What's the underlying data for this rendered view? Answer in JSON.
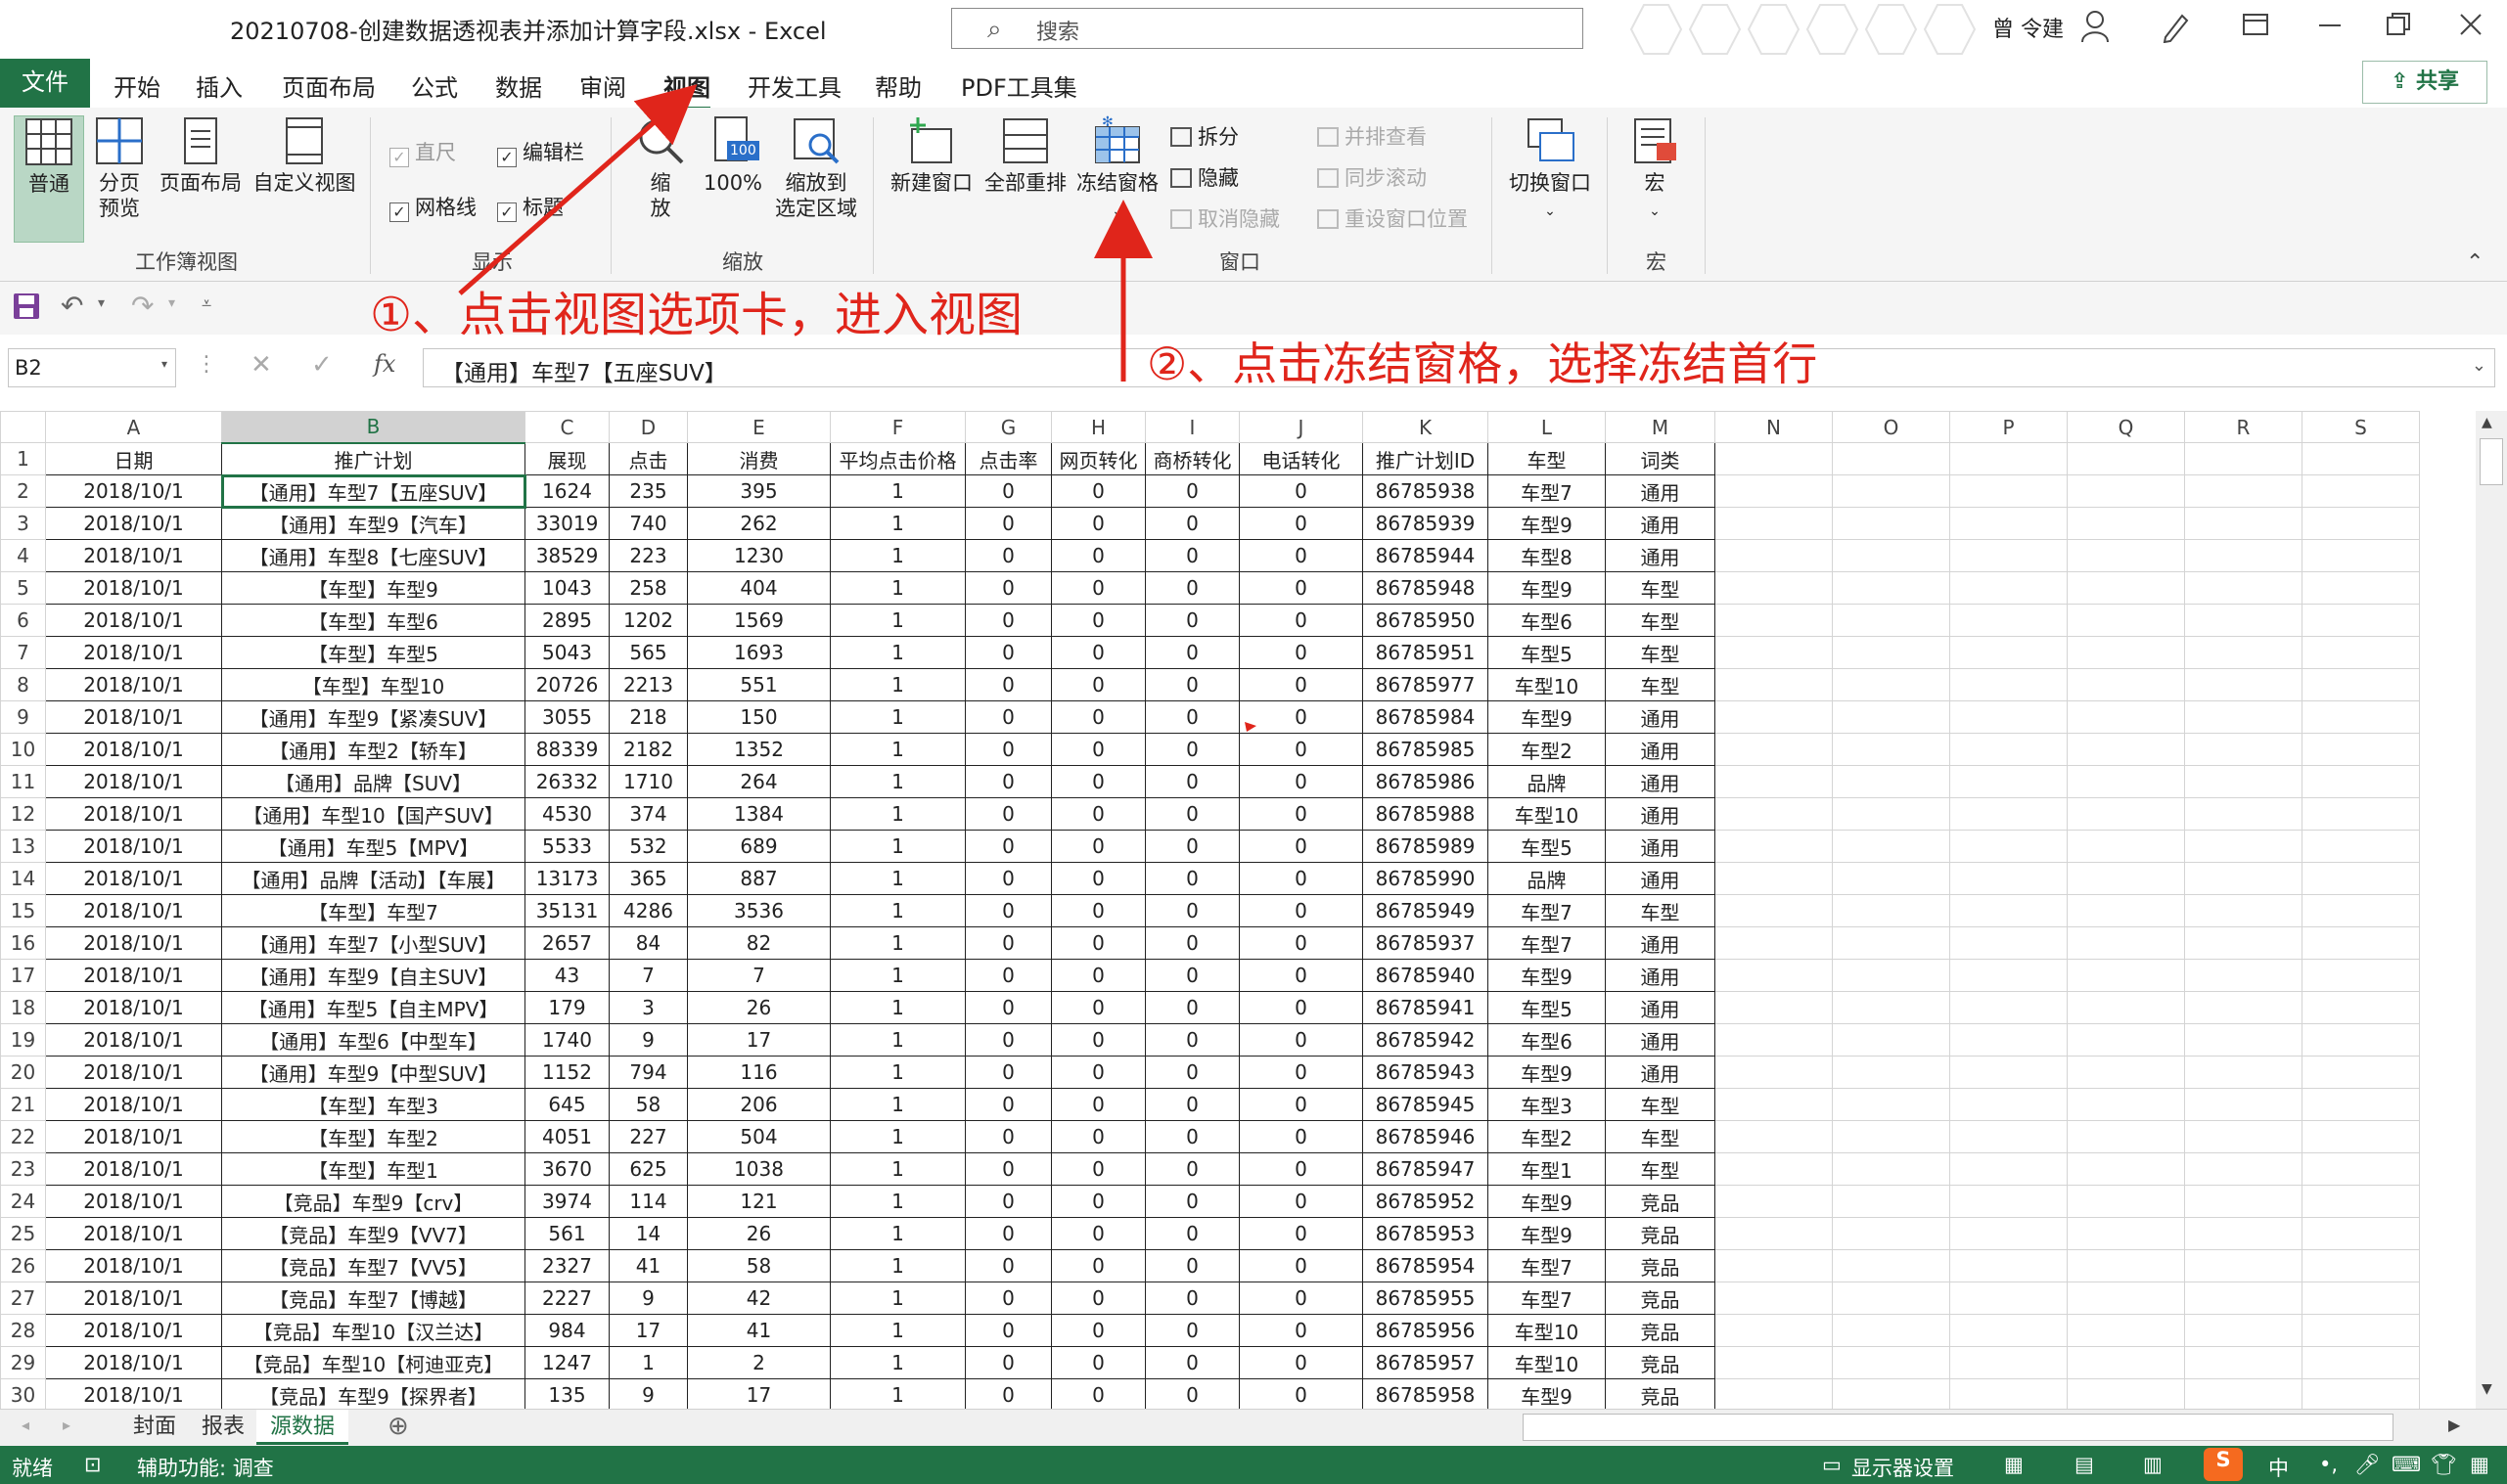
{
  "window": {
    "title": "20210708-创建数据透视表并添加计算字段.xlsx  -  Excel",
    "search_placeholder": "搜索",
    "user": "曾 令建"
  },
  "ribbon_tabs": [
    "文件",
    "开始",
    "插入",
    "页面布局",
    "公式",
    "数据",
    "审阅",
    "视图",
    "开发工具",
    "帮助",
    "PDF工具集"
  ],
  "active_tab": "视图",
  "share_label": "共享",
  "groups": {
    "workbook_views": {
      "label": "工作簿视图",
      "normal": "普通",
      "page_break_1": "分页",
      "page_break_2": "预览",
      "page_layout": "页面布局",
      "custom_views": "自定义视图"
    },
    "show": {
      "label": "显示",
      "ruler": "直尺",
      "formula_bar": "编辑栏",
      "gridlines": "网格线",
      "headings": "标题"
    },
    "zoom": {
      "label": "缩放",
      "zoom_1": "缩",
      "zoom_2": "放",
      "pct100": "100%",
      "pct100_badge": "100",
      "zoom_sel_1": "缩放到",
      "zoom_sel_2": "选定区域"
    },
    "window": {
      "label": "窗口",
      "new_window": "新建窗口",
      "arrange_all": "全部重排",
      "freeze_panes": "冻结窗格",
      "split": "拆分",
      "hide": "隐藏",
      "unhide": "取消隐藏",
      "side_by_side": "并排查看",
      "sync_scroll": "同步滚动",
      "reset_position": "重设窗口位置",
      "switch_windows": "切换窗口"
    },
    "macros": {
      "label": "宏",
      "macro": "宏"
    }
  },
  "annotations": {
    "step1": "①、点击视图选项卡，进入视图",
    "step2": "②、点击冻结窗格，选择冻结首行"
  },
  "formula": {
    "name_box": "B2",
    "content": "【通用】车型7【五座SUV】"
  },
  "column_letters": [
    "A",
    "B",
    "C",
    "D",
    "E",
    "F",
    "G",
    "H",
    "I",
    "J",
    "K",
    "L",
    "M",
    "N",
    "O",
    "P",
    "Q",
    "R",
    "S"
  ],
  "headers": [
    "日期",
    "推广计划",
    "展现",
    "点击",
    "消费",
    "平均点击价格",
    "点击率",
    "网页转化",
    "商桥转化",
    "电话转化",
    "推广计划ID",
    "车型",
    "词类"
  ],
  "rows": [
    [
      "2018/10/1",
      "【通用】车型7【五座SUV】",
      "1624",
      "235",
      "395",
      "1",
      "0",
      "0",
      "0",
      "0",
      "86785938",
      "车型7",
      "通用"
    ],
    [
      "2018/10/1",
      "【通用】车型9【汽车】",
      "33019",
      "740",
      "262",
      "1",
      "0",
      "0",
      "0",
      "0",
      "86785939",
      "车型9",
      "通用"
    ],
    [
      "2018/10/1",
      "【通用】车型8【七座SUV】",
      "38529",
      "223",
      "1230",
      "1",
      "0",
      "0",
      "0",
      "0",
      "86785944",
      "车型8",
      "通用"
    ],
    [
      "2018/10/1",
      "【车型】车型9",
      "1043",
      "258",
      "404",
      "1",
      "0",
      "0",
      "0",
      "0",
      "86785948",
      "车型9",
      "车型"
    ],
    [
      "2018/10/1",
      "【车型】车型6",
      "2895",
      "1202",
      "1569",
      "1",
      "0",
      "0",
      "0",
      "0",
      "86785950",
      "车型6",
      "车型"
    ],
    [
      "2018/10/1",
      "【车型】车型5",
      "5043",
      "565",
      "1693",
      "1",
      "0",
      "0",
      "0",
      "0",
      "86785951",
      "车型5",
      "车型"
    ],
    [
      "2018/10/1",
      "【车型】车型10",
      "20726",
      "2213",
      "551",
      "1",
      "0",
      "0",
      "0",
      "0",
      "86785977",
      "车型10",
      "车型"
    ],
    [
      "2018/10/1",
      "【通用】车型9【紧凑SUV】",
      "3055",
      "218",
      "150",
      "1",
      "0",
      "0",
      "0",
      "0",
      "86785984",
      "车型9",
      "通用"
    ],
    [
      "2018/10/1",
      "【通用】车型2【轿车】",
      "88339",
      "2182",
      "1352",
      "1",
      "0",
      "0",
      "0",
      "0",
      "86785985",
      "车型2",
      "通用"
    ],
    [
      "2018/10/1",
      "【通用】品牌【SUV】",
      "26332",
      "1710",
      "264",
      "1",
      "0",
      "0",
      "0",
      "0",
      "86785986",
      "品牌",
      "通用"
    ],
    [
      "2018/10/1",
      "【通用】车型10【国产SUV】",
      "4530",
      "374",
      "1384",
      "1",
      "0",
      "0",
      "0",
      "0",
      "86785988",
      "车型10",
      "通用"
    ],
    [
      "2018/10/1",
      "【通用】车型5【MPV】",
      "5533",
      "532",
      "689",
      "1",
      "0",
      "0",
      "0",
      "0",
      "86785989",
      "车型5",
      "通用"
    ],
    [
      "2018/10/1",
      "【通用】品牌【活动】【车展】",
      "13173",
      "365",
      "887",
      "1",
      "0",
      "0",
      "0",
      "0",
      "86785990",
      "品牌",
      "通用"
    ],
    [
      "2018/10/1",
      "【车型】车型7",
      "35131",
      "4286",
      "3536",
      "1",
      "0",
      "0",
      "0",
      "0",
      "86785949",
      "车型7",
      "车型"
    ],
    [
      "2018/10/1",
      "【通用】车型7【小型SUV】",
      "2657",
      "84",
      "82",
      "1",
      "0",
      "0",
      "0",
      "0",
      "86785937",
      "车型7",
      "通用"
    ],
    [
      "2018/10/1",
      "【通用】车型9【自主SUV】",
      "43",
      "7",
      "7",
      "1",
      "0",
      "0",
      "0",
      "0",
      "86785940",
      "车型9",
      "通用"
    ],
    [
      "2018/10/1",
      "【通用】车型5【自主MPV】",
      "179",
      "3",
      "26",
      "1",
      "0",
      "0",
      "0",
      "0",
      "86785941",
      "车型5",
      "通用"
    ],
    [
      "2018/10/1",
      "【通用】车型6【中型车】",
      "1740",
      "9",
      "17",
      "1",
      "0",
      "0",
      "0",
      "0",
      "86785942",
      "车型6",
      "通用"
    ],
    [
      "2018/10/1",
      "【通用】车型9【中型SUV】",
      "1152",
      "794",
      "116",
      "1",
      "0",
      "0",
      "0",
      "0",
      "86785943",
      "车型9",
      "通用"
    ],
    [
      "2018/10/1",
      "【车型】车型3",
      "645",
      "58",
      "206",
      "1",
      "0",
      "0",
      "0",
      "0",
      "86785945",
      "车型3",
      "车型"
    ],
    [
      "2018/10/1",
      "【车型】车型2",
      "4051",
      "227",
      "504",
      "1",
      "0",
      "0",
      "0",
      "0",
      "86785946",
      "车型2",
      "车型"
    ],
    [
      "2018/10/1",
      "【车型】车型1",
      "3670",
      "625",
      "1038",
      "1",
      "0",
      "0",
      "0",
      "0",
      "86785947",
      "车型1",
      "车型"
    ],
    [
      "2018/10/1",
      "【竞品】车型9【crv】",
      "3974",
      "114",
      "121",
      "1",
      "0",
      "0",
      "0",
      "0",
      "86785952",
      "车型9",
      "竞品"
    ],
    [
      "2018/10/1",
      "【竞品】车型9【VV7】",
      "561",
      "14",
      "26",
      "1",
      "0",
      "0",
      "0",
      "0",
      "86785953",
      "车型9",
      "竞品"
    ],
    [
      "2018/10/1",
      "【竞品】车型7【VV5】",
      "2327",
      "41",
      "58",
      "1",
      "0",
      "0",
      "0",
      "0",
      "86785954",
      "车型7",
      "竞品"
    ],
    [
      "2018/10/1",
      "【竞品】车型7【博越】",
      "2227",
      "9",
      "42",
      "1",
      "0",
      "0",
      "0",
      "0",
      "86785955",
      "车型7",
      "竞品"
    ],
    [
      "2018/10/1",
      "【竞品】车型10【汉兰达】",
      "984",
      "17",
      "41",
      "1",
      "0",
      "0",
      "0",
      "0",
      "86785956",
      "车型10",
      "竞品"
    ],
    [
      "2018/10/1",
      "【竞品】车型10【柯迪亚克】",
      "1247",
      "1",
      "2",
      "1",
      "0",
      "0",
      "0",
      "0",
      "86785957",
      "车型10",
      "竞品"
    ],
    [
      "2018/10/1",
      "【竞品】车型9【探界者】",
      "135",
      "9",
      "17",
      "1",
      "0",
      "0",
      "0",
      "0",
      "86785958",
      "车型9",
      "竞品"
    ]
  ],
  "sheets": [
    "封面",
    "报表",
    "源数据"
  ],
  "active_sheet": "源数据",
  "status": {
    "ready": "就绪",
    "accessibility": "辅助功能: 调查",
    "display_settings": "显示器设置",
    "ime": "中"
  },
  "colors": {
    "excel_green": "#217346",
    "annotation_red": "#e0251b"
  }
}
